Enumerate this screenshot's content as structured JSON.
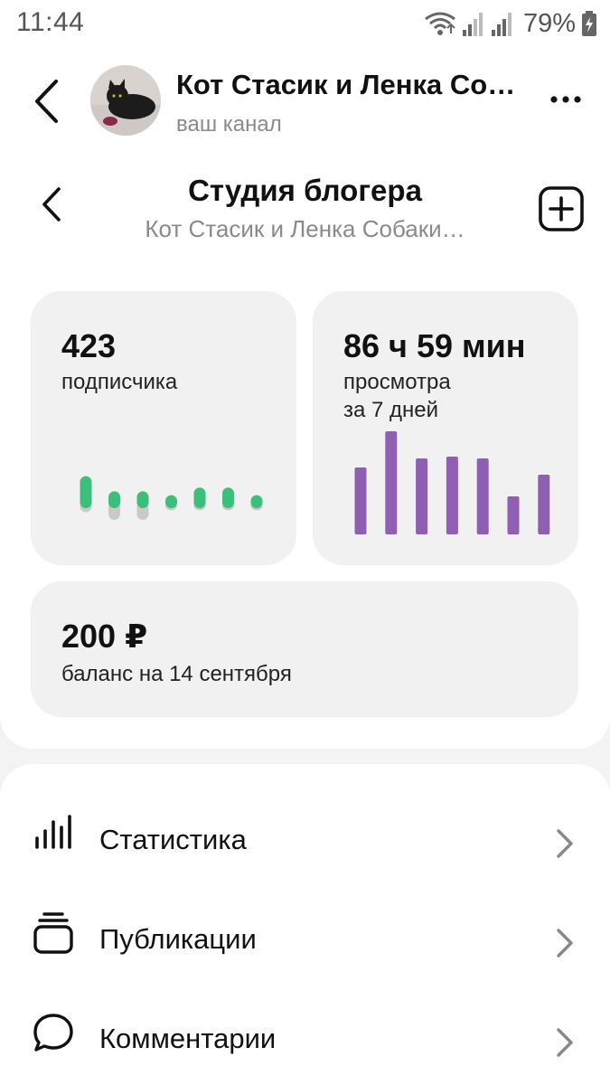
{
  "status_bar": {
    "time": "11:44",
    "battery_percent": "79%",
    "icons": [
      "wifi-icon",
      "signal-icon",
      "signal-icon",
      "battery-charging-icon"
    ]
  },
  "channel_header": {
    "name": "Кот Стасик и Ленка Со…",
    "subtitle": "ваш канал",
    "back_icon": "chevron-left-icon",
    "more_icon": "more-dots-icon"
  },
  "studio_header": {
    "title": "Студия блогера",
    "subtitle": "Кот Стасик и Ленка Собаки…",
    "add_icon": "plus-square-icon"
  },
  "cards": {
    "subscribers": {
      "value": "423",
      "label": "подписчика",
      "accent": "#3cbf7a"
    },
    "views": {
      "value": "86 ч 59 мин",
      "label_line1": "просмотра",
      "label_line2": "за 7 дней",
      "accent": "#8e5fb3"
    },
    "balance": {
      "value": "200 ₽",
      "label": "баланс на 14 сентября"
    }
  },
  "chart_data": [
    {
      "type": "bar",
      "name_on_card": "подписчика",
      "series": [
        {
          "values_gain": [
            28,
            12,
            12,
            8,
            16,
            16,
            8
          ]
        },
        {
          "values_loss": [
            10,
            18,
            18,
            8,
            8,
            8,
            8
          ]
        }
      ],
      "colors": {
        "gain": "#3cbf7a",
        "loss": "#c9c9c9"
      }
    },
    {
      "type": "bar",
      "name_on_card": "просмотра за 7 дней",
      "values": [
        74,
        114,
        84,
        86,
        84,
        42,
        66
      ],
      "color": "#8e5fb3"
    }
  ],
  "menu": {
    "items": [
      {
        "label": "Статистика",
        "icon": "bar-chart-icon"
      },
      {
        "label": "Публикации",
        "icon": "stack-icon"
      },
      {
        "label": "Комментарии",
        "icon": "comment-icon"
      }
    ],
    "chevron_icon": "chevron-right-icon"
  },
  "colors": {
    "background": "#f3f3f3",
    "panel": "#ffffff",
    "card": "#f1f1f1",
    "muted_text": "#8a8a8a"
  }
}
